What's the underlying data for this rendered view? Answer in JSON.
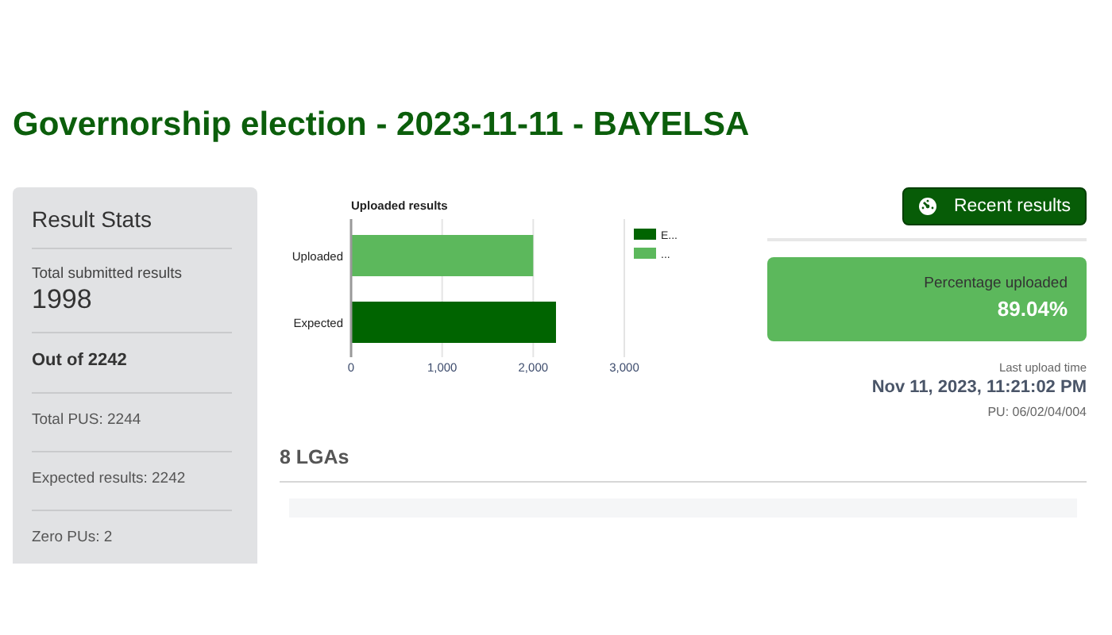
{
  "page": {
    "title": "Governorship election - 2023-11-11 - BAYELSA"
  },
  "result_stats": {
    "title": "Result Stats",
    "total_label": "Total submitted results",
    "total_value": "1998",
    "rows": [
      {
        "text": "Out of 2242",
        "kind": "bold"
      },
      {
        "text": "Total PUS: 2244",
        "kind": "plain"
      },
      {
        "text": "Expected results: 2242",
        "kind": "plain"
      },
      {
        "text": "Zero PUs: 2",
        "kind": "plain"
      }
    ]
  },
  "chart": {
    "chart_data": {
      "type": "bar",
      "orientation": "horizontal",
      "title": "Uploaded results",
      "categories": [
        "Uploaded",
        "Expected"
      ],
      "legend": "right",
      "series": [
        {
          "name": "E...",
          "color": "#006400",
          "values": [
            null,
            2250
          ]
        },
        {
          "name": "...",
          "color": "#5cb85c",
          "values": [
            2000,
            null
          ]
        }
      ],
      "xlim": [
        0,
        3000
      ],
      "xticks": [
        {
          "value": 0,
          "label": "0"
        },
        {
          "value": 1000,
          "label": "1,000"
        },
        {
          "value": 2000,
          "label": "2,000"
        },
        {
          "value": 3000,
          "label": "3,000"
        }
      ]
    }
  },
  "recent_button": {
    "label": "Recent results"
  },
  "percentage": {
    "label": "Percentage uploaded",
    "value": "89.04%"
  },
  "last_upload": {
    "label": "Last upload time",
    "time": "Nov 11, 2023, 11:21:02 PM",
    "pu": "PU: 06/02/04/004"
  },
  "lgas": {
    "title": "8 LGAs"
  }
}
